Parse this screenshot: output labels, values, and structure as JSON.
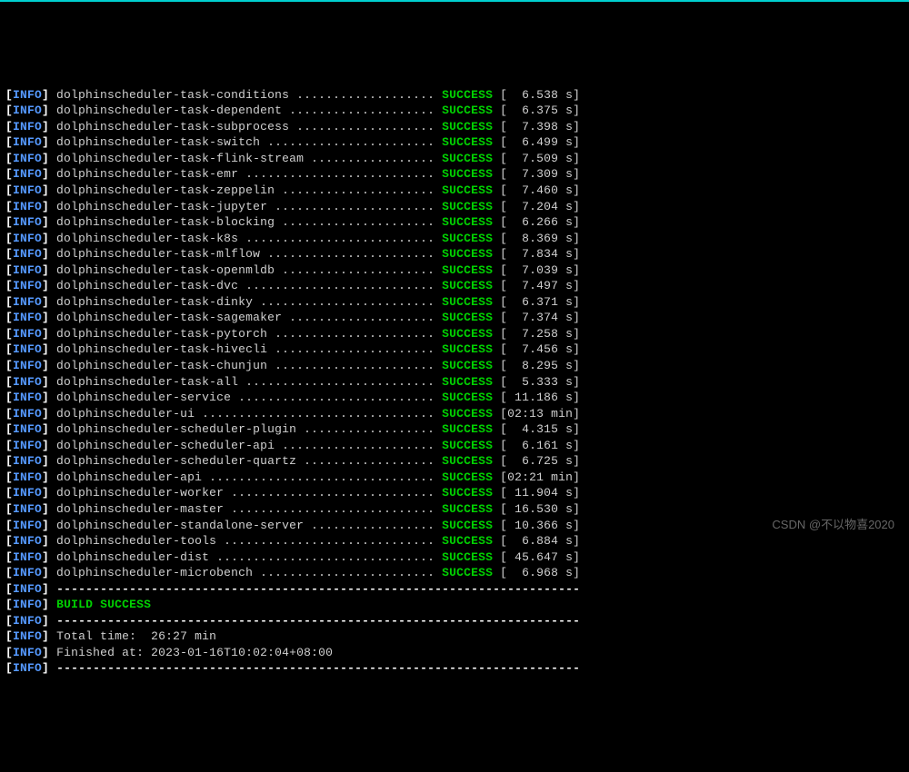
{
  "tag": "INFO",
  "status": "SUCCESS",
  "build_result": "BUILD SUCCESS",
  "separator": "------------------------------------------------------------------------",
  "modules": [
    {
      "name": "dolphinscheduler-task-conditions",
      "time": "  6.538 s"
    },
    {
      "name": "dolphinscheduler-task-dependent",
      "time": "  6.375 s"
    },
    {
      "name": "dolphinscheduler-task-subprocess",
      "time": "  7.398 s"
    },
    {
      "name": "dolphinscheduler-task-switch",
      "time": "  6.499 s"
    },
    {
      "name": "dolphinscheduler-task-flink-stream",
      "time": "  7.509 s"
    },
    {
      "name": "dolphinscheduler-task-emr",
      "time": "  7.309 s"
    },
    {
      "name": "dolphinscheduler-task-zeppelin",
      "time": "  7.460 s"
    },
    {
      "name": "dolphinscheduler-task-jupyter",
      "time": "  7.204 s"
    },
    {
      "name": "dolphinscheduler-task-blocking",
      "time": "  6.266 s"
    },
    {
      "name": "dolphinscheduler-task-k8s",
      "time": "  8.369 s"
    },
    {
      "name": "dolphinscheduler-task-mlflow",
      "time": "  7.834 s"
    },
    {
      "name": "dolphinscheduler-task-openmldb",
      "time": "  7.039 s"
    },
    {
      "name": "dolphinscheduler-task-dvc",
      "time": "  7.497 s"
    },
    {
      "name": "dolphinscheduler-task-dinky",
      "time": "  6.371 s"
    },
    {
      "name": "dolphinscheduler-task-sagemaker",
      "time": "  7.374 s"
    },
    {
      "name": "dolphinscheduler-task-pytorch",
      "time": "  7.258 s"
    },
    {
      "name": "dolphinscheduler-task-hivecli",
      "time": "  7.456 s"
    },
    {
      "name": "dolphinscheduler-task-chunjun",
      "time": "  8.295 s"
    },
    {
      "name": "dolphinscheduler-task-all",
      "time": "  5.333 s"
    },
    {
      "name": "dolphinscheduler-service",
      "time": " 11.186 s"
    },
    {
      "name": "dolphinscheduler-ui",
      "time": "02:13 min"
    },
    {
      "name": "dolphinscheduler-scheduler-plugin",
      "time": "  4.315 s"
    },
    {
      "name": "dolphinscheduler-scheduler-api",
      "time": "  6.161 s"
    },
    {
      "name": "dolphinscheduler-scheduler-quartz",
      "time": "  6.725 s"
    },
    {
      "name": "dolphinscheduler-api",
      "time": "02:21 min"
    },
    {
      "name": "dolphinscheduler-worker",
      "time": " 11.904 s"
    },
    {
      "name": "dolphinscheduler-master",
      "time": " 16.530 s"
    },
    {
      "name": "dolphinscheduler-standalone-server",
      "time": " 10.366 s"
    },
    {
      "name": "dolphinscheduler-tools",
      "time": "  6.884 s"
    },
    {
      "name": "dolphinscheduler-dist",
      "time": " 45.647 s"
    },
    {
      "name": "dolphinscheduler-microbench",
      "time": "  6.968 s"
    }
  ],
  "summary": {
    "total_time_label": "Total time:  ",
    "total_time_value": "26:27 min",
    "finished_label": "Finished at: ",
    "finished_value": "2023-01-16T10:02:04+08:00"
  },
  "watermark": "CSDN @不以物喜2020",
  "module_col_width": 52
}
